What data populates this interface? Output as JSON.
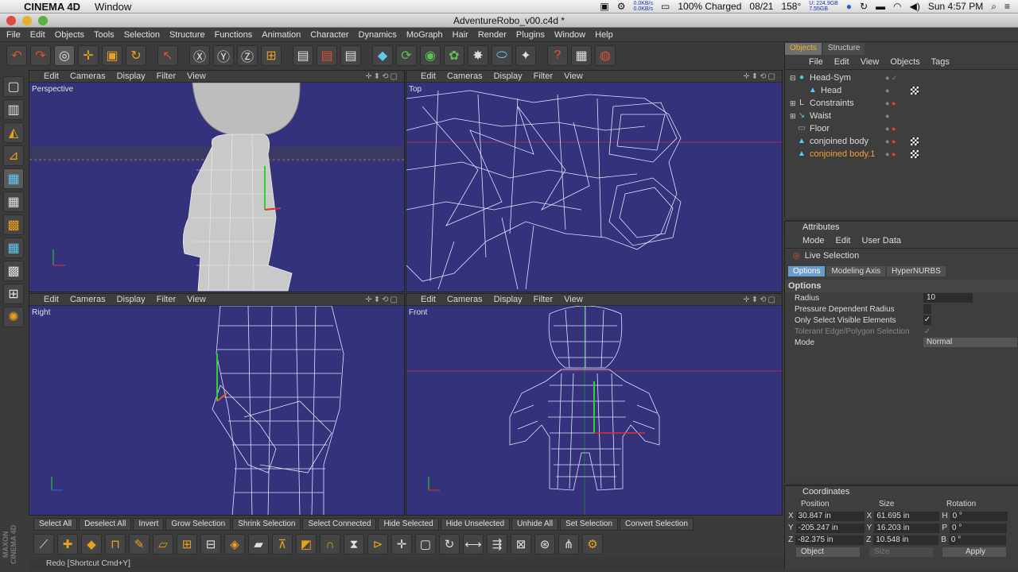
{
  "mac_menubar": {
    "app_name": "CINEMA 4D",
    "menu": "Window",
    "net_speed_top": "0.0KB/s",
    "net_speed_bottom": "0.0KB/s",
    "battery": "100% Charged",
    "date": "08/21",
    "temperature": "158°",
    "mem_top": "U: 224.9GB",
    "mem_bottom": "7.55GB",
    "clock": "Sun 4:57 PM"
  },
  "window": {
    "title": "AdventureRobo_v00.c4d *"
  },
  "main_menu": [
    "File",
    "Edit",
    "Objects",
    "Tools",
    "Selection",
    "Structure",
    "Functions",
    "Animation",
    "Character",
    "Dynamics",
    "MoGraph",
    "Hair",
    "Render",
    "Plugins",
    "Window",
    "Help"
  ],
  "viewport_menu": [
    "Edit",
    "Cameras",
    "Display",
    "Filter",
    "View"
  ],
  "viewports": {
    "perspective": "Perspective",
    "top": "Top",
    "right": "Right",
    "front": "Front"
  },
  "object_manager": {
    "tabs": [
      "Objects",
      "Structure"
    ],
    "menu": [
      "File",
      "Edit",
      "View",
      "Objects",
      "Tags"
    ],
    "objects": [
      {
        "name": "Head-Sym",
        "icon": "symmetry-icon"
      },
      {
        "name": "Head",
        "icon": "polygon-icon"
      },
      {
        "name": "Constraints",
        "icon": "null-icon"
      },
      {
        "name": "Waist",
        "icon": "bone-icon"
      },
      {
        "name": "Floor",
        "icon": "floor-icon"
      },
      {
        "name": "conjoined body",
        "icon": "polygon-icon"
      },
      {
        "name": "conjoined body.1",
        "icon": "polygon-icon",
        "selected": true
      }
    ]
  },
  "attributes": {
    "title": "Attributes",
    "menu": [
      "Mode",
      "Edit",
      "User Data"
    ],
    "tool_name": "Live Selection",
    "tabs": [
      "Options",
      "Modeling Axis",
      "HyperNURBS"
    ],
    "section": "Options",
    "rows": [
      {
        "label": "Radius",
        "value": "10"
      },
      {
        "label": "Pressure Dependent Radius",
        "value": ""
      },
      {
        "label": "Only Select Visible Elements",
        "value": "✓"
      },
      {
        "label": "Tolerant Edge/Polygon Selection",
        "value": "✓"
      },
      {
        "label": "Mode",
        "value": "Normal"
      }
    ]
  },
  "coordinates": {
    "title": "Coordinates",
    "headers": [
      "Position",
      "Size",
      "Rotation"
    ],
    "rows": [
      {
        "axis": "X",
        "pos": "30.847 in",
        "size_axis": "X",
        "size": "61.695 in",
        "rot_axis": "H",
        "rot": "0 °"
      },
      {
        "axis": "Y",
        "pos": "-205.247 in",
        "size_axis": "Y",
        "size": "16.203 in",
        "rot_axis": "P",
        "rot": "0 °"
      },
      {
        "axis": "Z",
        "pos": "-82.375 in",
        "size_axis": "Z",
        "size": "10.548 in",
        "rot_axis": "B",
        "rot": "0 °"
      }
    ],
    "mode": "Object",
    "size_mode": "Size",
    "apply": "Apply"
  },
  "selection_bar": [
    "Select All",
    "Deselect All",
    "Invert",
    "Grow Selection",
    "Shrink Selection",
    "Select Connected",
    "Hide Selected",
    "Hide Unselected",
    "Unhide All",
    "Set Selection",
    "Convert Selection"
  ],
  "status": "Redo [Shortcut Cmd+Y]",
  "brand": "MAXON CINEMA 4D"
}
